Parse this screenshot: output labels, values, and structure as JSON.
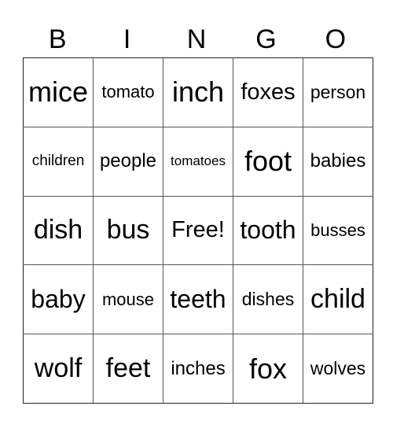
{
  "header": [
    "B",
    "I",
    "N",
    "G",
    "O"
  ],
  "cells": [
    [
      "mice",
      "tomato",
      "inch",
      "foxes",
      "person"
    ],
    [
      "children",
      "people",
      "tomatoes",
      "foot",
      "babies"
    ],
    [
      "dish",
      "bus",
      "Free!",
      "tooth",
      "busses"
    ],
    [
      "baby",
      "mouse",
      "teeth",
      "dishes",
      "child"
    ],
    [
      "wolf",
      "feet",
      "inches",
      "fox",
      "wolves"
    ]
  ]
}
